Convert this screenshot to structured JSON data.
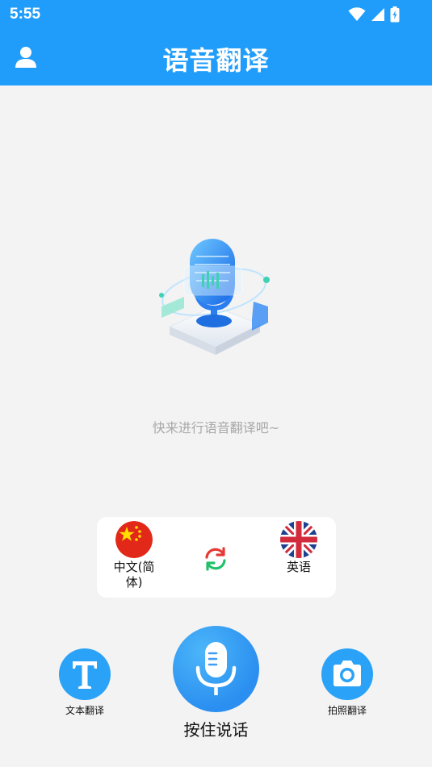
{
  "status_bar": {
    "time": "5:55"
  },
  "header": {
    "title": "语音翻译",
    "profile_icon": "user-icon"
  },
  "main": {
    "hint": "快来进行语音翻译吧~"
  },
  "languages": {
    "source": {
      "label": "中文(简体)",
      "flag": "china-flag"
    },
    "target": {
      "label": "英语",
      "flag": "uk-flag"
    },
    "swap_icon": "swap-arrows-icon"
  },
  "actions": {
    "text_translate": {
      "label": "文本翻译",
      "icon": "text-T-icon"
    },
    "hold_to_speak": {
      "label": "按住说话",
      "icon": "microphone-icon"
    },
    "photo_translate": {
      "label": "拍照翻译",
      "icon": "camera-icon"
    }
  },
  "colors": {
    "primary": "#209dfb",
    "background": "#f3f3f3",
    "swap_red": "#e53935",
    "swap_green": "#21c06b"
  }
}
